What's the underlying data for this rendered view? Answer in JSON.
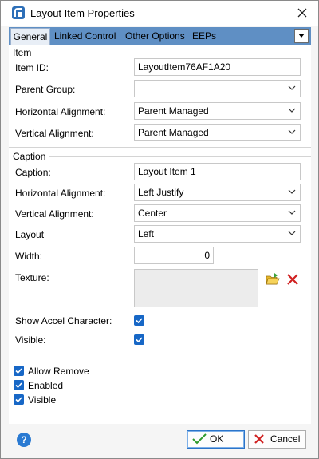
{
  "window": {
    "title": "Layout Item Properties"
  },
  "tabs": [
    {
      "label": "General",
      "active": true
    },
    {
      "label": "Linked Control",
      "active": false
    },
    {
      "label": "Other Options",
      "active": false
    },
    {
      "label": "EEPs",
      "active": false
    }
  ],
  "item_section": {
    "title": "Item",
    "item_id_label": "Item ID:",
    "item_id_value": "LayoutItem76AF1A20",
    "parent_group_label": "Parent Group:",
    "parent_group_value": "",
    "h_align_label": "Horizontal Alignment:",
    "h_align_value": "Parent Managed",
    "v_align_label": "Vertical Alignment:",
    "v_align_value": "Parent Managed"
  },
  "caption_section": {
    "title": "Caption",
    "caption_label": "Caption:",
    "caption_value": "Layout Item 1",
    "h_align_label": "Horizontal Alignment:",
    "h_align_value": "Left Justify",
    "v_align_label": "Vertical Alignment:",
    "v_align_value": "Center",
    "layout_label": "Layout",
    "layout_value": "Left",
    "width_label": "Width:",
    "width_value": "0",
    "texture_label": "Texture:",
    "show_accel_label": "Show Accel Character:",
    "show_accel_checked": true,
    "visible_label": "Visible:",
    "visible_checked": true
  },
  "options": {
    "allow_remove_label": "Allow Remove",
    "allow_remove_checked": true,
    "enabled_label": "Enabled",
    "enabled_checked": true,
    "visible_label": "Visible",
    "visible_checked": true
  },
  "footer": {
    "help_label": "?",
    "ok_label": "OK",
    "cancel_label": "Cancel"
  },
  "colors": {
    "tab_strip": "#5f8fc4",
    "checkbox": "#1767c6",
    "ok_glyph": "#2e9b2e",
    "cancel_glyph": "#d02020"
  }
}
